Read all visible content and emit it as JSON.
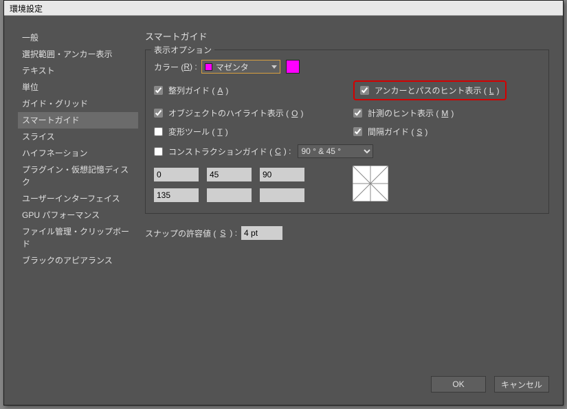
{
  "window": {
    "title": "環境設定"
  },
  "sidebar": {
    "items": [
      {
        "label": "一般"
      },
      {
        "label": "選択範囲・アンカー表示"
      },
      {
        "label": "テキスト"
      },
      {
        "label": "単位"
      },
      {
        "label": "ガイド・グリッド"
      },
      {
        "label": "スマートガイド"
      },
      {
        "label": "スライス"
      },
      {
        "label": "ハイフネーション"
      },
      {
        "label": "プラグイン・仮想記憶ディスク"
      },
      {
        "label": "ユーザーインターフェイス"
      },
      {
        "label": "GPU パフォーマンス"
      },
      {
        "label": "ファイル管理・クリップボード"
      },
      {
        "label": "ブラックのアピアランス"
      }
    ],
    "selected_index": 5
  },
  "main": {
    "title": "スマートガイド",
    "display_options": {
      "legend": "表示オプション",
      "color_label_pre": "カラー (",
      "color_label_key": "R",
      "color_label_post": ") :",
      "color_value": "マゼンタ",
      "color_hex": "#ff00ff",
      "align_guides": {
        "checked": true,
        "label_pre": "整列ガイド (",
        "key": "A",
        "label_post": ")"
      },
      "anchor_path_hint": {
        "checked": true,
        "label_pre": "アンカーとパスのヒント表示 (",
        "key": "L",
        "label_post": ")"
      },
      "object_highlight": {
        "checked": true,
        "label_pre": "オブジェクトのハイライト表示 (",
        "key": "O",
        "label_post": ")"
      },
      "measure_hint": {
        "checked": true,
        "label_pre": "計測のヒント表示 (",
        "key": "M",
        "label_post": ")"
      },
      "transform_tool": {
        "checked": false,
        "label_pre": "変形ツール (",
        "key": "T",
        "label_post": ")"
      },
      "spacing_guides": {
        "checked": true,
        "label_pre": "間隔ガイド (",
        "key": "S",
        "label_post": ")"
      },
      "construction_guides": {
        "checked": false,
        "label_pre": "コンストラクションガイド (",
        "key": "C",
        "label_post": ") :",
        "preset": "90 °  & 45 °"
      },
      "angles": {
        "a0": "0",
        "a1": "45",
        "a2": "90",
        "a3": "135",
        "a4": "",
        "a5": ""
      }
    },
    "snap": {
      "label_pre": "スナップの許容値 (",
      "key": "S",
      "label_post": ") :",
      "value": "4 pt"
    },
    "buttons": {
      "ok": "OK",
      "cancel": "キャンセル"
    }
  }
}
